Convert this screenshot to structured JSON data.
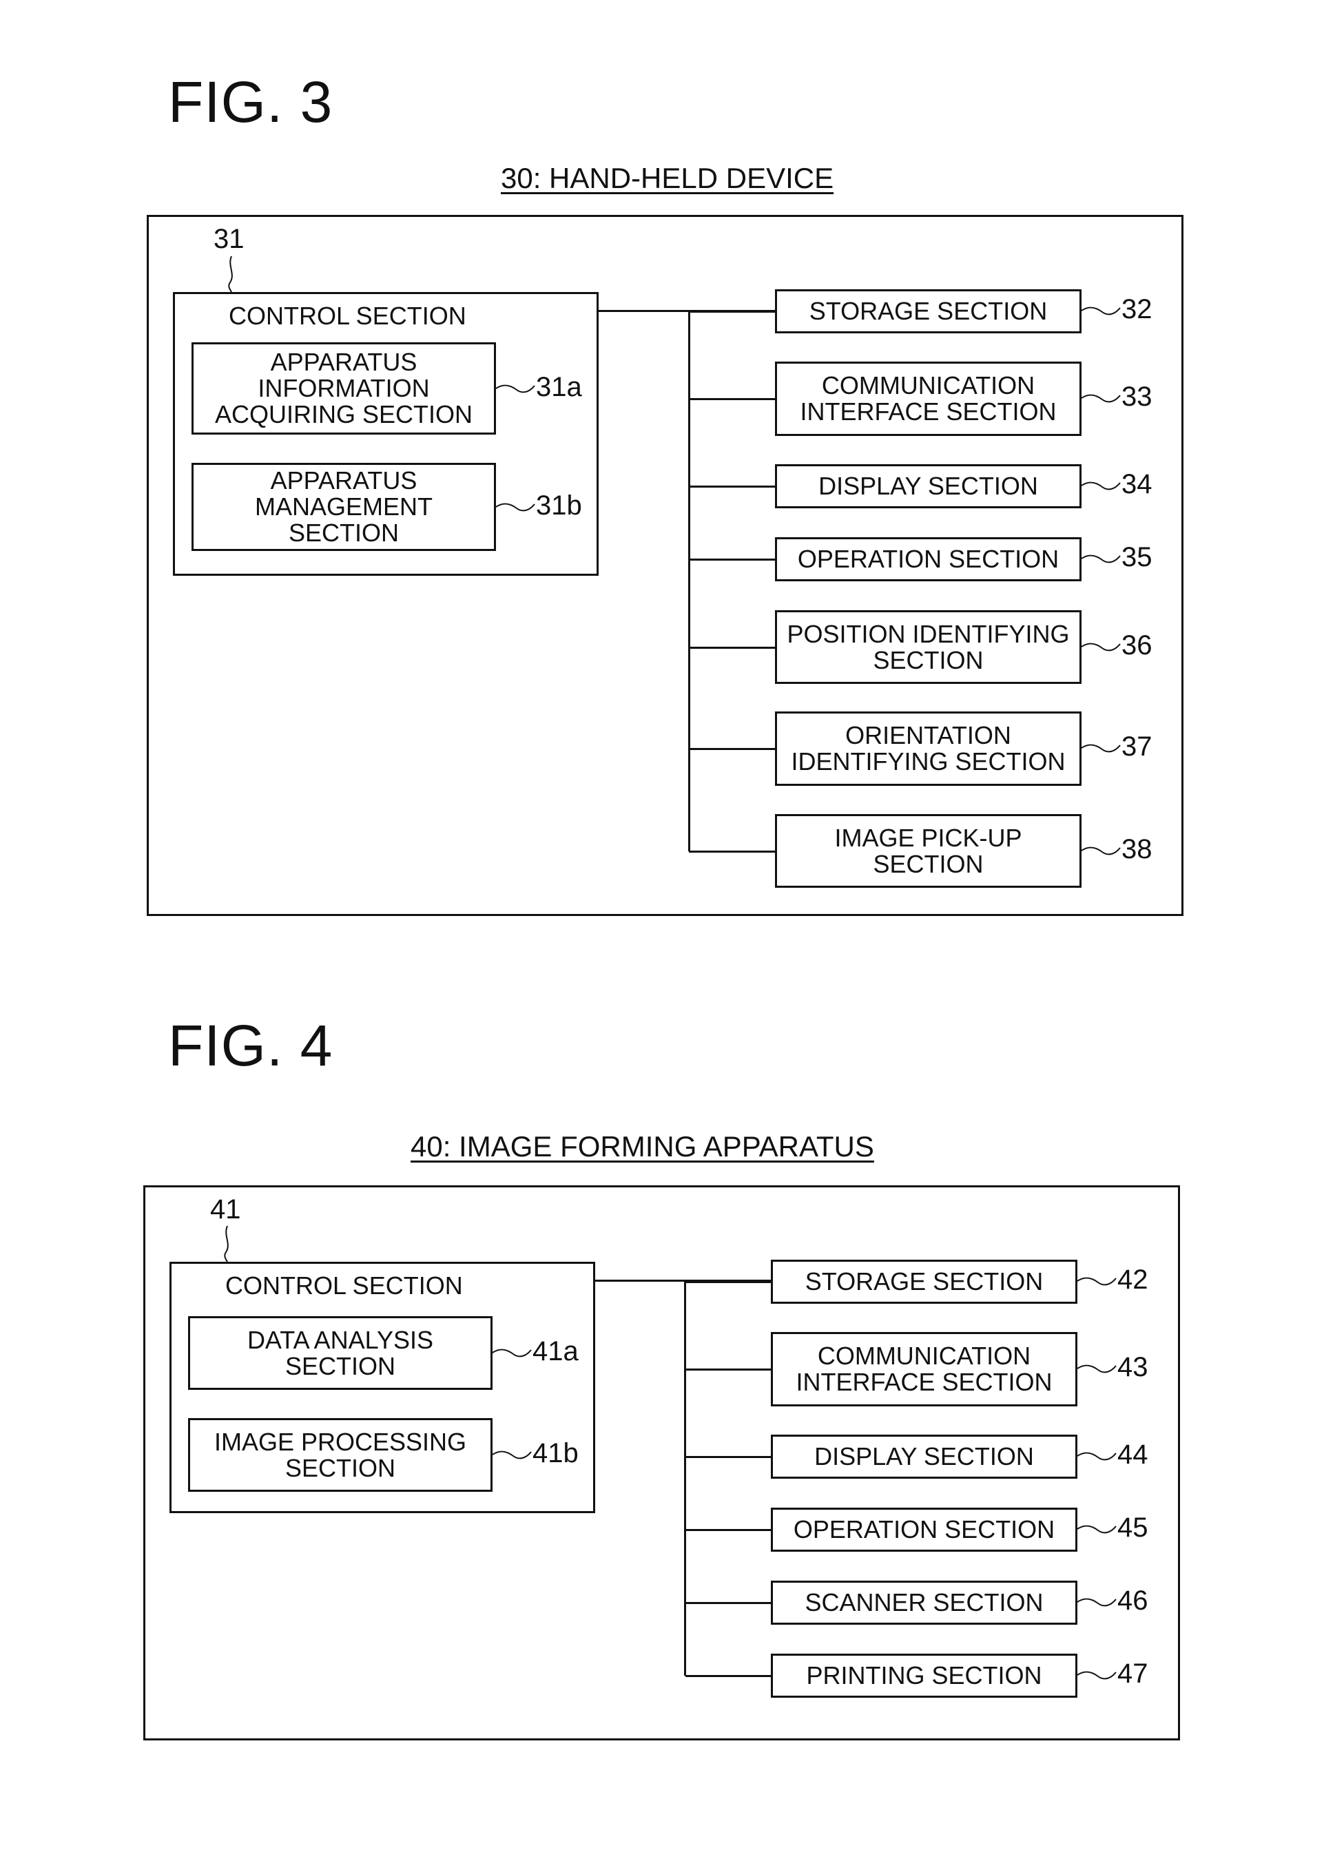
{
  "fig3": {
    "figure_label": "FIG. 3",
    "title": "30: HAND-HELD DEVICE",
    "control": {
      "ref": "31",
      "label": "CONTROL SECTION",
      "subs": [
        {
          "ref": "31a",
          "label": "APPARATUS\nINFORMATION\nACQUIRING SECTION"
        },
        {
          "ref": "31b",
          "label": "APPARATUS\nMANAGEMENT\nSECTION"
        }
      ]
    },
    "sections": [
      {
        "ref": "32",
        "label": "STORAGE SECTION"
      },
      {
        "ref": "33",
        "label": "COMMUNICATION\nINTERFACE SECTION"
      },
      {
        "ref": "34",
        "label": "DISPLAY SECTION"
      },
      {
        "ref": "35",
        "label": "OPERATION SECTION"
      },
      {
        "ref": "36",
        "label": "POSITION IDENTIFYING\nSECTION"
      },
      {
        "ref": "37",
        "label": "ORIENTATION\nIDENTIFYING SECTION"
      },
      {
        "ref": "38",
        "label": "IMAGE PICK-UP\nSECTION"
      }
    ]
  },
  "fig4": {
    "figure_label": "FIG. 4",
    "title": "40: IMAGE FORMING APPARATUS",
    "control": {
      "ref": "41",
      "label": "CONTROL SECTION",
      "subs": [
        {
          "ref": "41a",
          "label": "DATA ANALYSIS\nSECTION"
        },
        {
          "ref": "41b",
          "label": "IMAGE PROCESSING\nSECTION"
        }
      ]
    },
    "sections": [
      {
        "ref": "42",
        "label": "STORAGE SECTION"
      },
      {
        "ref": "43",
        "label": "COMMUNICATION\nINTERFACE SECTION"
      },
      {
        "ref": "44",
        "label": "DISPLAY SECTION"
      },
      {
        "ref": "45",
        "label": "OPERATION SECTION"
      },
      {
        "ref": "46",
        "label": "SCANNER SECTION"
      },
      {
        "ref": "47",
        "label": "PRINTING SECTION"
      }
    ]
  }
}
